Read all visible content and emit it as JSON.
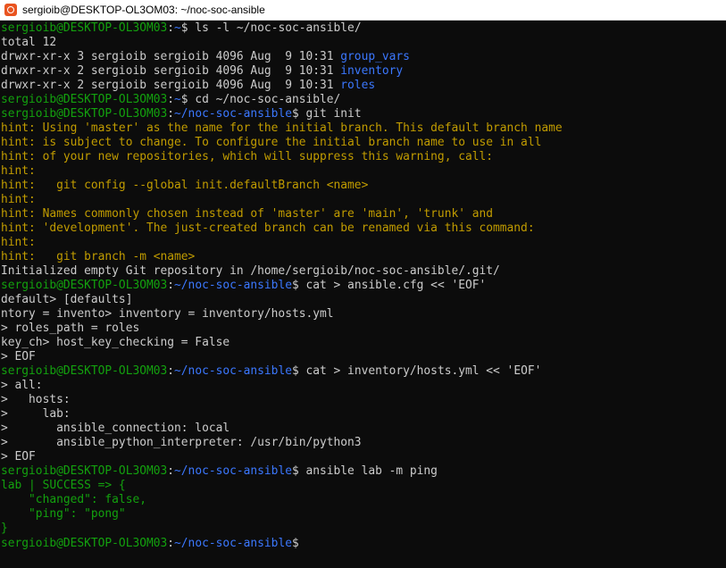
{
  "window": {
    "title": "sergioib@DESKTOP-OL3OM03: ~/noc-soc-ansible",
    "icon": "ubuntu-icon",
    "accent": "#e95420"
  },
  "colors": {
    "prompt_user": "#13a10e",
    "prompt_path": "#3b78ff",
    "text": "#cccccc",
    "hint": "#c19c00",
    "success": "#13a10e",
    "background": "#0c0c0c"
  },
  "terminal": {
    "lines": [
      [
        {
          "t": "sergioib@DESKTOP-OL3OM03",
          "c": "green"
        },
        {
          "t": ":",
          "c": "white"
        },
        {
          "t": "~",
          "c": "blue"
        },
        {
          "t": "$ ls -l ~/noc-soc-ansible/",
          "c": "white"
        }
      ],
      [
        {
          "t": "total 12",
          "c": "white"
        }
      ],
      [
        {
          "t": "drwxr-xr-x 3 sergioib sergioib 4096 Aug  9 10:31 ",
          "c": "white"
        },
        {
          "t": "group_vars",
          "c": "blue"
        }
      ],
      [
        {
          "t": "drwxr-xr-x 2 sergioib sergioib 4096 Aug  9 10:31 ",
          "c": "white"
        },
        {
          "t": "inventory",
          "c": "blue"
        }
      ],
      [
        {
          "t": "drwxr-xr-x 2 sergioib sergioib 4096 Aug  9 10:31 ",
          "c": "white"
        },
        {
          "t": "roles",
          "c": "blue"
        }
      ],
      [
        {
          "t": "sergioib@DESKTOP-OL3OM03",
          "c": "green"
        },
        {
          "t": ":",
          "c": "white"
        },
        {
          "t": "~",
          "c": "blue"
        },
        {
          "t": "$ cd ~/noc-soc-ansible/",
          "c": "white"
        }
      ],
      [
        {
          "t": "sergioib@DESKTOP-OL3OM03",
          "c": "green"
        },
        {
          "t": ":",
          "c": "white"
        },
        {
          "t": "~/noc-soc-ansible",
          "c": "blue"
        },
        {
          "t": "$ git init",
          "c": "white"
        }
      ],
      [
        {
          "t": "hint: Using 'master' as the name for the initial branch. This default branch name",
          "c": "yellow"
        }
      ],
      [
        {
          "t": "hint: is subject to change. To configure the initial branch name to use in all",
          "c": "yellow"
        }
      ],
      [
        {
          "t": "hint: of your new repositories, which will suppress this warning, call:",
          "c": "yellow"
        }
      ],
      [
        {
          "t": "hint:",
          "c": "yellow"
        }
      ],
      [
        {
          "t": "hint:   git config --global init.defaultBranch <name>",
          "c": "yellow"
        }
      ],
      [
        {
          "t": "hint:",
          "c": "yellow"
        }
      ],
      [
        {
          "t": "hint: Names commonly chosen instead of 'master' are 'main', 'trunk' and",
          "c": "yellow"
        }
      ],
      [
        {
          "t": "hint: 'development'. The just-created branch can be renamed via this command:",
          "c": "yellow"
        }
      ],
      [
        {
          "t": "hint:",
          "c": "yellow"
        }
      ],
      [
        {
          "t": "hint:   git branch -m <name>",
          "c": "yellow"
        }
      ],
      [
        {
          "t": "Initialized empty Git repository in /home/sergioib/noc-soc-ansible/.git/",
          "c": "white"
        }
      ],
      [
        {
          "t": "sergioib@DESKTOP-OL3OM03",
          "c": "green"
        },
        {
          "t": ":",
          "c": "white"
        },
        {
          "t": "~/noc-soc-ansible",
          "c": "blue"
        },
        {
          "t": "$ cat > ansible.cfg << 'EOF'",
          "c": "white"
        }
      ],
      [
        {
          "t": "default> [defaults]",
          "c": "white"
        }
      ],
      [
        {
          "t": "ntory = invento> inventory = inventory/hosts.yml",
          "c": "white"
        }
      ],
      [
        {
          "t": "> roles_path = roles",
          "c": "white"
        }
      ],
      [
        {
          "t": "key_ch> host_key_checking = False",
          "c": "white"
        }
      ],
      [
        {
          "t": "> EOF",
          "c": "white"
        }
      ],
      [
        {
          "t": "sergioib@DESKTOP-OL3OM03",
          "c": "green"
        },
        {
          "t": ":",
          "c": "white"
        },
        {
          "t": "~/noc-soc-ansible",
          "c": "blue"
        },
        {
          "t": "$ cat > inventory/hosts.yml << 'EOF'",
          "c": "white"
        }
      ],
      [
        {
          "t": "> all:",
          "c": "white"
        }
      ],
      [
        {
          "t": ">   hosts:",
          "c": "white"
        }
      ],
      [
        {
          "t": ">     lab:",
          "c": "white"
        }
      ],
      [
        {
          "t": ">       ansible_connection: local",
          "c": "white"
        }
      ],
      [
        {
          "t": ">       ansible_python_interpreter: /usr/bin/python3",
          "c": "white"
        }
      ],
      [
        {
          "t": "> EOF",
          "c": "white"
        }
      ],
      [
        {
          "t": "sergioib@DESKTOP-OL3OM03",
          "c": "green"
        },
        {
          "t": ":",
          "c": "white"
        },
        {
          "t": "~/noc-soc-ansible",
          "c": "blue"
        },
        {
          "t": "$ ansible lab -m ping",
          "c": "white"
        }
      ],
      [
        {
          "t": "lab | SUCCESS => {",
          "c": "green"
        }
      ],
      [
        {
          "t": "    \"changed\": false,",
          "c": "green"
        }
      ],
      [
        {
          "t": "    \"ping\": \"pong\"",
          "c": "green"
        }
      ],
      [
        {
          "t": "}",
          "c": "green"
        }
      ],
      [
        {
          "t": "sergioib@DESKTOP-OL3OM03",
          "c": "green"
        },
        {
          "t": ":",
          "c": "white"
        },
        {
          "t": "~/noc-soc-ansible",
          "c": "blue"
        },
        {
          "t": "$ ",
          "c": "white"
        }
      ]
    ]
  }
}
